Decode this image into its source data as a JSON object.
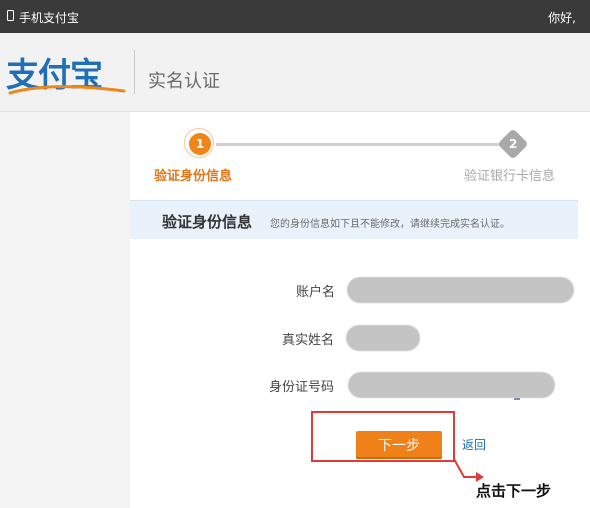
{
  "topbar": {
    "site_name": "手机支付宝",
    "greeting": "你好,"
  },
  "header": {
    "logo_text": "支付宝",
    "page_title": "实名认证"
  },
  "steps": [
    {
      "number": "1",
      "label": "验证身份信息",
      "state": "active"
    },
    {
      "number": "2",
      "label": "验证银行卡信息",
      "state": "pending"
    }
  ],
  "section": {
    "title": "验证身份信息",
    "description": "您的身份信息如下且不能修改，请继续完成实名认证。"
  },
  "form": {
    "account_label": "账户名",
    "realname_label": "真实姓名",
    "idno_label": "身份证号码"
  },
  "actions": {
    "next_label": "下一步",
    "back_label": "返回"
  },
  "annotation": {
    "text": "点击下一步"
  },
  "colors": {
    "accent_orange": "#ef8118",
    "brand_blue": "#1f6fb8",
    "highlight_red": "#e13a3a"
  }
}
